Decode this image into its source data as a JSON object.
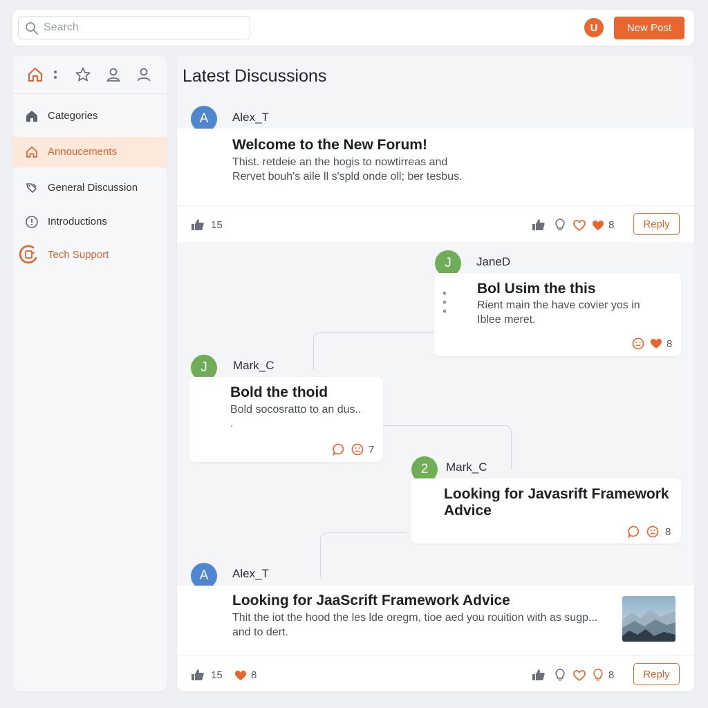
{
  "topbar": {
    "search_placeholder": "Search",
    "user_initial": "U",
    "new_post_label": "New Post"
  },
  "sidebar": {
    "icons": [
      "home-icon",
      "more-icon",
      "star-icon",
      "user-icon",
      "profile-icon"
    ],
    "items": [
      {
        "label": "Categories",
        "icon": "home-icon"
      },
      {
        "label": "Annoucements",
        "icon": "house-outline-icon"
      },
      {
        "label": "General Discussion",
        "icon": "tag-icon"
      },
      {
        "label": "Introductions",
        "icon": "info-icon"
      },
      {
        "label": "Tech Support",
        "icon": "support-icon"
      }
    ]
  },
  "main": {
    "title": "Latest Discussions",
    "posts": [
      {
        "avatar": "A",
        "author": "Alex_T",
        "title": "Welcome to the New Forum!",
        "body_line1": "Thist. retdeie an the hogis to nowtirreas and",
        "body_line2": "Rervet bouh's aile ll s'spld onde oll; ber tesbus.",
        "likes": "15",
        "reactions": "8",
        "reply_label": "Reply"
      },
      {
        "avatar": "J",
        "author": "JaneD",
        "title": "Bol  Usim the this",
        "body_line1": "Rient main the have covier yos in",
        "body_line2": "Iblee meret.",
        "reactions": "8"
      },
      {
        "avatar": "J",
        "author": "Mark_C",
        "title": "Bold the thoid",
        "body_line1": "Bold socosratto to an dus..",
        "body_line2": ".",
        "reactions": "7"
      },
      {
        "avatar": "2",
        "author": "Mark_C",
        "title_line1": "Looking for Javasrift Framework",
        "title_line2": "Advice",
        "reactions": "8"
      },
      {
        "avatar": "A",
        "author": "Alex_T",
        "title": "Looking for JaaScrift Framework Advice",
        "body_line1": "Thit the iot the hood the les lde oregm, tioe aed you rouition with as sugp...",
        "body_line2": "and to dert.",
        "likes": "15",
        "hearts": "8",
        "reactions": "8",
        "reply_label": "Reply"
      }
    ]
  },
  "colors": {
    "accent": "#e8672f",
    "avatar_blue": "#4e86cf",
    "avatar_green": "#6fae56"
  }
}
